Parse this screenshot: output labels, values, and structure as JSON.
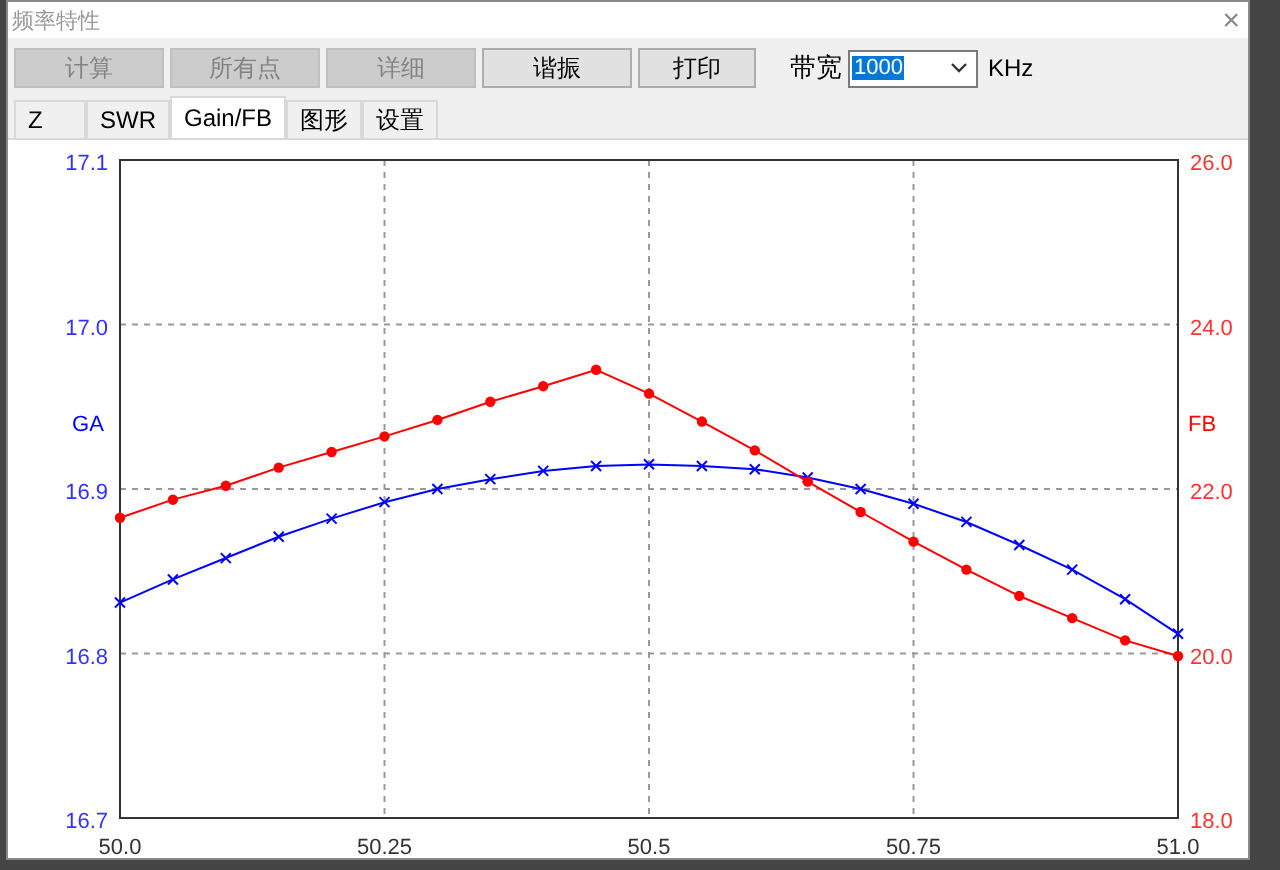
{
  "window": {
    "title": "频率特性",
    "close": "×"
  },
  "toolbar": [
    {
      "label": "计算",
      "disabled": true
    },
    {
      "label": "所有点",
      "disabled": true
    },
    {
      "label": "详细",
      "disabled": true
    },
    {
      "label": "谐振",
      "disabled": false
    },
    {
      "label": "打印",
      "disabled": false
    }
  ],
  "bandwidth": {
    "label": "带宽",
    "value": "1000",
    "unit": "KHz"
  },
  "tabs": [
    {
      "label": "Z",
      "selected": false
    },
    {
      "label": "SWR",
      "selected": false
    },
    {
      "label": "Gain/FB",
      "selected": true
    },
    {
      "label": "图形",
      "selected": false
    },
    {
      "label": "设置",
      "selected": false
    }
  ],
  "chart_data": {
    "type": "line",
    "grid": true,
    "x": [
      50.0,
      50.05,
      50.1,
      50.15,
      50.2,
      50.25,
      50.3,
      50.35,
      50.4,
      50.45,
      50.5,
      50.55,
      50.6,
      50.65,
      50.7,
      50.75,
      50.8,
      50.85,
      50.9,
      50.95,
      51.0
    ],
    "xlim": [
      50.0,
      51.0
    ],
    "xticks": [
      {
        "value": 50.0,
        "label": "50.0"
      },
      {
        "value": 50.25,
        "label": "50.25"
      },
      {
        "value": 50.5,
        "label": "50.5"
      },
      {
        "value": 50.75,
        "label": "50.75"
      },
      {
        "value": 51.0,
        "label": "51.0"
      }
    ],
    "ylim": [
      16.7,
      17.1
    ],
    "yticks": [
      {
        "value": 16.7,
        "label": "16.7"
      },
      {
        "value": 16.8,
        "label": "16.8"
      },
      {
        "value": 16.9,
        "label": "16.9"
      },
      {
        "value": 17.0,
        "label": "17.0"
      },
      {
        "value": 17.1,
        "label": "17.1"
      }
    ],
    "y2lim": [
      18.0,
      26.0
    ],
    "y2ticks": [
      {
        "value": 18,
        "label": "18.0"
      },
      {
        "value": 20,
        "label": "20.0"
      },
      {
        "value": 22,
        "label": "22.0"
      },
      {
        "value": 24,
        "label": "24.0"
      },
      {
        "value": 26,
        "label": "26.0"
      }
    ],
    "series": [
      {
        "name": "GA",
        "color": "#0000ff",
        "axis": "y",
        "marker": "cross",
        "values": [
          16.831,
          16.845,
          16.858,
          16.871,
          16.882,
          16.892,
          16.9,
          16.906,
          16.911,
          16.914,
          16.915,
          16.914,
          16.912,
          16.907,
          16.9,
          16.891,
          16.88,
          16.866,
          16.851,
          16.833,
          16.812
        ]
      },
      {
        "name": "FB",
        "color": "#ff0000",
        "axis": "y2",
        "marker": "dot",
        "values": [
          21.65,
          21.87,
          22.04,
          22.26,
          22.45,
          22.64,
          22.84,
          23.06,
          23.25,
          23.45,
          23.16,
          22.82,
          22.47,
          22.09,
          21.72,
          21.36,
          21.02,
          20.7,
          20.43,
          20.16,
          19.97
        ]
      }
    ]
  }
}
